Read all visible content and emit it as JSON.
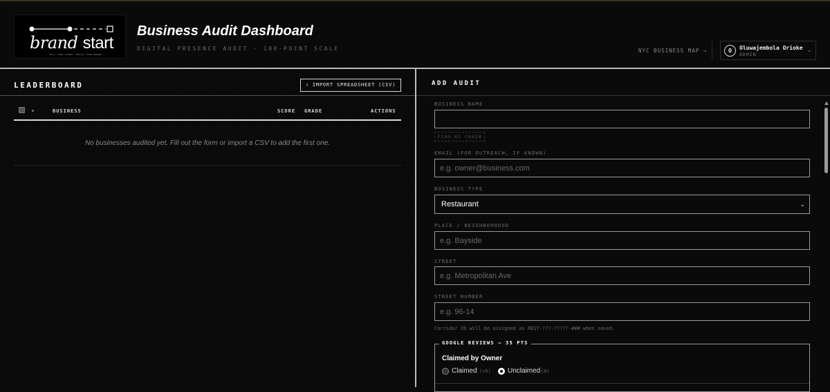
{
  "header": {
    "logo": {
      "word_italic": "brand",
      "word_plain": "start",
      "tagline": "TELL YOUR STORY. BUILD YOUR BRAND."
    },
    "title": "Business Audit Dashboard",
    "subtitle": "DIGITAL PRESENCE AUDIT · 100-POINT SCALE",
    "map_link": "NYC BUSINESS MAP →",
    "user": {
      "initial": "O",
      "name": "Oluwajembola Orioke",
      "role": "ADMIN",
      "caret": "⌄"
    }
  },
  "leaderboard": {
    "title": "LEADERBOARD",
    "import_label": "↑ IMPORT SPREADSHEET (CSV)",
    "columns": {
      "business": "BUSINESS",
      "score": "SCORE",
      "grade": "GRADE",
      "actions": "ACTIONS"
    },
    "empty_text": "No businesses audited yet. Fill out the form or import a CSV to add the first one."
  },
  "form": {
    "title": "ADD AUDIT",
    "business_name": {
      "label": "BUSINESS NAME",
      "value": ""
    },
    "flag_chain": "FLAG AS CHAIN",
    "email": {
      "label": "EMAIL (FOR OUTREACH, IF KNOWN)",
      "placeholder": "e.g. owner@business.com"
    },
    "business_type": {
      "label": "BUSINESS TYPE",
      "selected": "Restaurant"
    },
    "place": {
      "label": "PLACE / NEIGHBORHOOD",
      "placeholder": "e.g. Bayside"
    },
    "street": {
      "label": "STREET",
      "placeholder": "e.g. Metropolitan Ave"
    },
    "street_number": {
      "label": "STREET NUMBER",
      "placeholder": "e.g. 96-14"
    },
    "corridor_hint": "Corridor ID will be assigned as REST-???-?????-### when saved.",
    "google_reviews": {
      "legend": "GOOGLE REVIEWS — 35 PTS",
      "question": "Claimed by Owner",
      "options": [
        {
          "label": "Claimed",
          "points": "(+5)",
          "selected": false
        },
        {
          "label": "Unclaimed",
          "points": "(0)",
          "selected": true
        }
      ]
    }
  }
}
